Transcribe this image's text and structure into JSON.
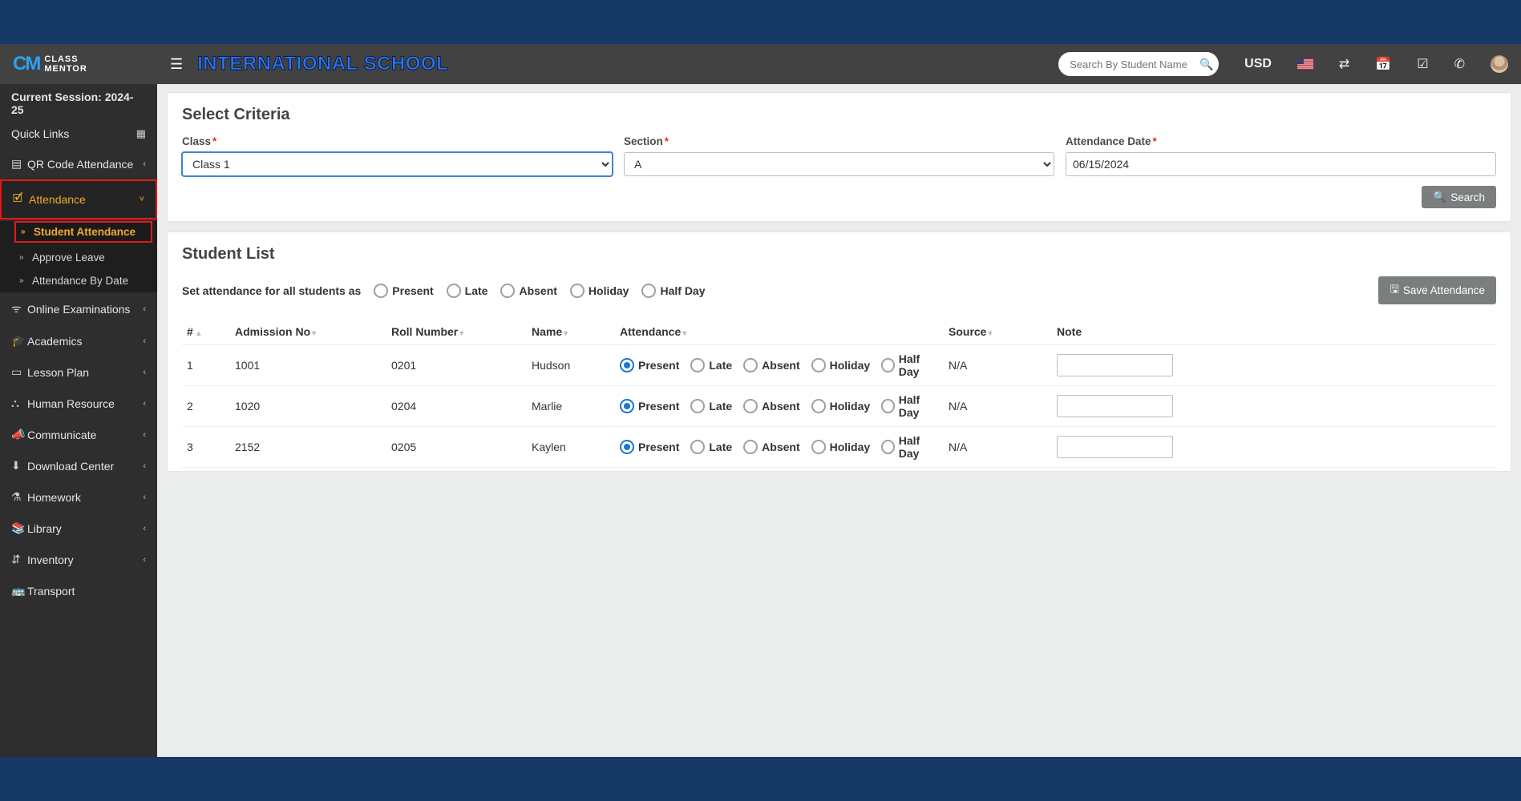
{
  "header": {
    "school_name": "INTERNATIONAL SCHOOL",
    "search_placeholder": "Search By Student Name",
    "currency": "USD"
  },
  "logo": {
    "class_label": "CLASS",
    "mentor_label": "MENTOR"
  },
  "session": {
    "label": "Current Session: 2024-25",
    "quick_links": "Quick Links"
  },
  "sidebar": {
    "items": [
      {
        "label": "QR Code Attendance",
        "icon": "▤"
      },
      {
        "label": "Attendance",
        "icon": "✔",
        "active": true,
        "open": true,
        "children": [
          {
            "label": "Student Attendance",
            "active": true
          },
          {
            "label": "Approve Leave"
          },
          {
            "label": "Attendance By Date"
          }
        ]
      },
      {
        "label": "Online Examinations",
        "icon": "◈"
      },
      {
        "label": "Academics",
        "icon": "🎓"
      },
      {
        "label": "Lesson Plan",
        "icon": "▭"
      },
      {
        "label": "Human Resource",
        "icon": "⛬"
      },
      {
        "label": "Communicate",
        "icon": "📣"
      },
      {
        "label": "Download Center",
        "icon": "⬇"
      },
      {
        "label": "Homework",
        "icon": "⚗"
      },
      {
        "label": "Library",
        "icon": "📚"
      },
      {
        "label": "Inventory",
        "icon": "⇵"
      },
      {
        "label": "Transport",
        "icon": "🚌"
      }
    ]
  },
  "criteria": {
    "title": "Select Criteria",
    "class_label": "Class",
    "class_value": "Class 1",
    "section_label": "Section",
    "section_value": "A",
    "date_label": "Attendance Date",
    "date_value": "06/15/2024",
    "search_btn": "Search"
  },
  "bulk": {
    "prompt": "Set attendance for all students as",
    "options": [
      "Present",
      "Late",
      "Absent",
      "Holiday",
      "Half Day"
    ],
    "save_btn": "Save Attendance"
  },
  "list": {
    "title": "Student List",
    "columns": {
      "index": "#",
      "admission": "Admission No",
      "roll": "Roll Number",
      "name": "Name",
      "attendance": "Attendance",
      "source": "Source",
      "note": "Note"
    },
    "att_options": [
      "Present",
      "Late",
      "Absent",
      "Holiday",
      "Half Day"
    ],
    "rows": [
      {
        "idx": "1",
        "admission_no": "1001",
        "roll": "0201",
        "name": "Hudson",
        "attendance": "Present",
        "source": "N/A"
      },
      {
        "idx": "2",
        "admission_no": "1020",
        "roll": "0204",
        "name": "Marlie",
        "attendance": "Present",
        "source": "N/A"
      },
      {
        "idx": "3",
        "admission_no": "2152",
        "roll": "0205",
        "name": "Kaylen",
        "attendance": "Present",
        "source": "N/A"
      }
    ]
  }
}
